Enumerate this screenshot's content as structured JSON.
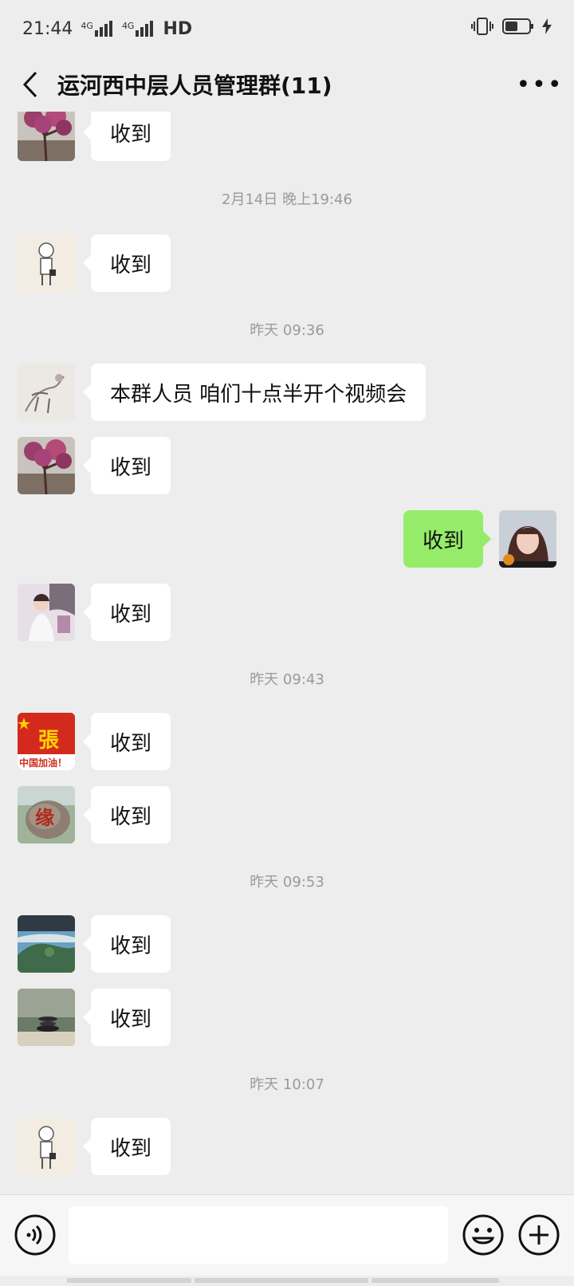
{
  "status_bar": {
    "time": "21:44",
    "signal1": "4G",
    "signal2": "4G",
    "hd": "HD"
  },
  "header": {
    "title": "运河西中层人员管理群(11)",
    "back_icon": "chevron-left-icon",
    "more_icon": "more-icon",
    "more_label": "•••"
  },
  "messages": [
    {
      "side": "left",
      "text": "收到",
      "avatar": "plum-tree"
    },
    {
      "type": "timestamp",
      "text": "2月14日 晚上19:46"
    },
    {
      "side": "left",
      "text": "收到",
      "avatar": "cartoon-man"
    },
    {
      "type": "timestamp",
      "text": "昨天 09:36"
    },
    {
      "side": "left",
      "text": "本群人员 咱们十点半开个视频会",
      "avatar": "sketch-horse"
    },
    {
      "side": "left",
      "text": "收到",
      "avatar": "plum-tree"
    },
    {
      "side": "right",
      "text": "收到",
      "avatar": "woman-portrait"
    },
    {
      "side": "left",
      "text": "收到",
      "avatar": "girl-photo"
    },
    {
      "type": "timestamp",
      "text": "昨天 09:43"
    },
    {
      "side": "left",
      "text": "收到",
      "avatar": "zhang-china",
      "avatar_text_top": "張",
      "avatar_text_bottom": "中国加油！"
    },
    {
      "side": "left",
      "text": "收到",
      "avatar": "yuan-stone",
      "avatar_text": "缘"
    },
    {
      "type": "timestamp",
      "text": "昨天 09:53"
    },
    {
      "side": "left",
      "text": "收到",
      "avatar": "mountain-landscape"
    },
    {
      "side": "left",
      "text": "收到",
      "avatar": "stacked-stones"
    },
    {
      "type": "timestamp",
      "text": "昨天 10:07"
    },
    {
      "side": "left",
      "text": "收到",
      "avatar": "cartoon-man"
    }
  ],
  "input_bar": {
    "voice_icon": "voice-icon",
    "emoji_icon": "emoji-icon",
    "plus_icon": "plus-icon",
    "input_value": ""
  },
  "colors": {
    "background": "#ededed",
    "bubble_self": "#95ec69",
    "bubble_other": "#ffffff",
    "timestamp": "#9a9a9a"
  }
}
